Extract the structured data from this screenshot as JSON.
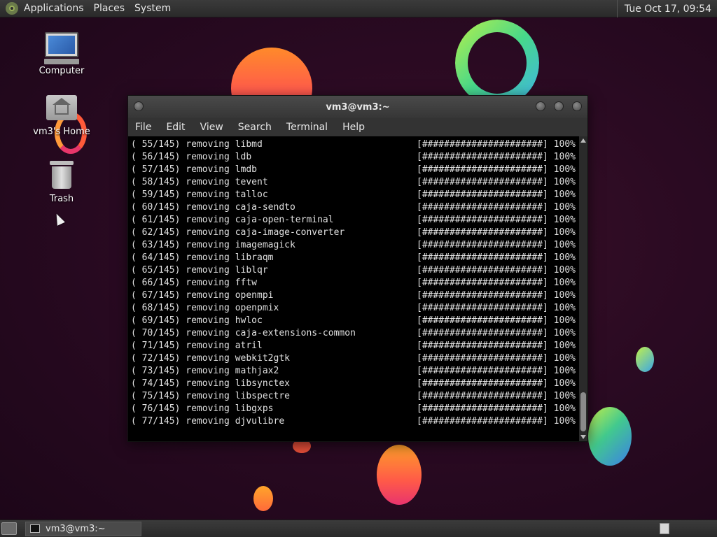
{
  "top_panel": {
    "menus": [
      "Applications",
      "Places",
      "System"
    ],
    "clock": "Tue Oct 17, 09:54"
  },
  "desktop_icons": {
    "computer": "Computer",
    "home": "vm3's Home",
    "trash": "Trash"
  },
  "terminal": {
    "title": "vm3@vm3:~",
    "menus": [
      "File",
      "Edit",
      "View",
      "Search",
      "Terminal",
      "Help"
    ],
    "lines": [
      {
        "text": "( 55/145) removing libmd",
        "progress": "[######################] 100%"
      },
      {
        "text": "( 56/145) removing ldb",
        "progress": "[######################] 100%"
      },
      {
        "text": "( 57/145) removing lmdb",
        "progress": "[######################] 100%"
      },
      {
        "text": "( 58/145) removing tevent",
        "progress": "[######################] 100%"
      },
      {
        "text": "( 59/145) removing talloc",
        "progress": "[######################] 100%"
      },
      {
        "text": "( 60/145) removing caja-sendto",
        "progress": "[######################] 100%"
      },
      {
        "text": "( 61/145) removing caja-open-terminal",
        "progress": "[######################] 100%"
      },
      {
        "text": "( 62/145) removing caja-image-converter",
        "progress": "[######################] 100%"
      },
      {
        "text": "( 63/145) removing imagemagick",
        "progress": "[######################] 100%"
      },
      {
        "text": "( 64/145) removing libraqm",
        "progress": "[######################] 100%"
      },
      {
        "text": "( 65/145) removing liblqr",
        "progress": "[######################] 100%"
      },
      {
        "text": "( 66/145) removing fftw",
        "progress": "[######################] 100%"
      },
      {
        "text": "( 67/145) removing openmpi",
        "progress": "[######################] 100%"
      },
      {
        "text": "( 68/145) removing openpmix",
        "progress": "[######################] 100%"
      },
      {
        "text": "( 69/145) removing hwloc",
        "progress": "[######################] 100%"
      },
      {
        "text": "( 70/145) removing caja-extensions-common",
        "progress": "[######################] 100%"
      },
      {
        "text": "( 71/145) removing atril",
        "progress": "[######################] 100%"
      },
      {
        "text": "( 72/145) removing webkit2gtk",
        "progress": "[######################] 100%"
      },
      {
        "text": "( 73/145) removing mathjax2",
        "progress": "[######################] 100%"
      },
      {
        "text": "( 74/145) removing libsynctex",
        "progress": "[######################] 100%"
      },
      {
        "text": "( 75/145) removing libspectre",
        "progress": "[######################] 100%"
      },
      {
        "text": "( 76/145) removing libgxps",
        "progress": "[######################] 100%"
      },
      {
        "text": "( 77/145) removing djvulibre",
        "progress": "[######################] 100%"
      }
    ]
  },
  "taskbar": {
    "task_label": "vm3@vm3:~"
  },
  "colors": {
    "terminal_bg": "#000000",
    "terminal_fg": "#e0e0e0",
    "panel_bg": "#2e2e2e",
    "wallpaper_bg": "#2a0a22"
  }
}
